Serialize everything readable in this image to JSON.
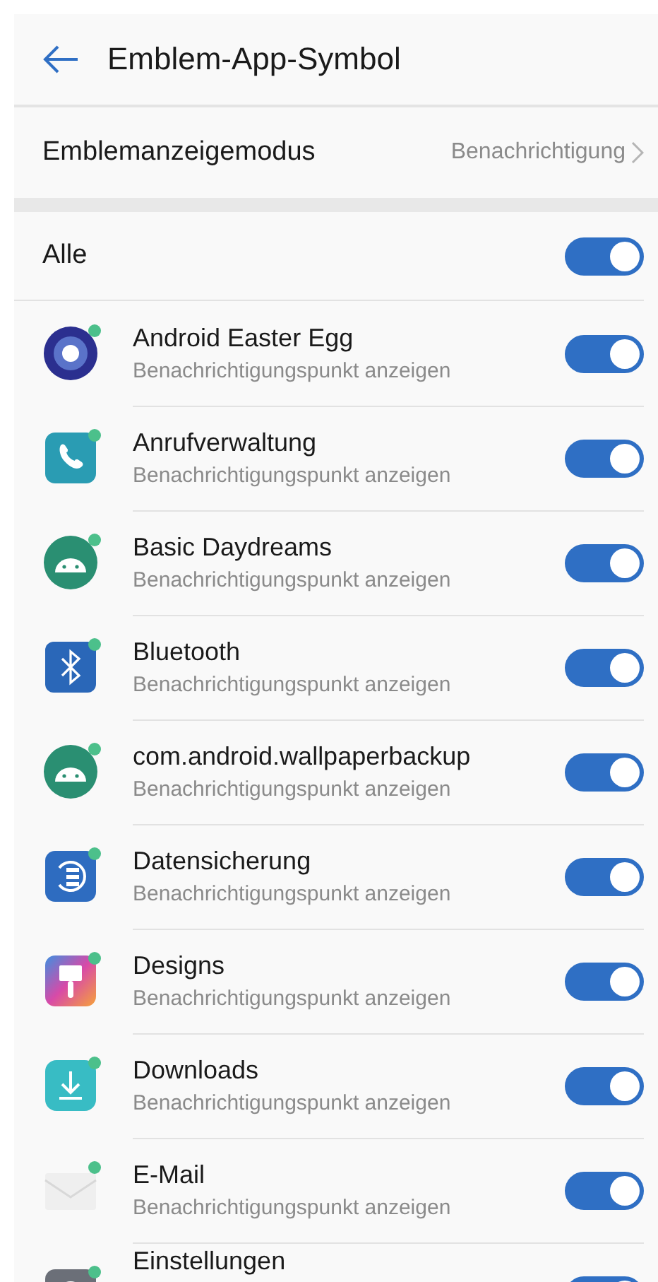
{
  "header": {
    "title": "Emblem-App-Symbol"
  },
  "mode": {
    "label": "Emblemanzeigemodus",
    "value": "Benachrichtigung"
  },
  "all": {
    "label": "Alle",
    "on": true
  },
  "apps": [
    {
      "name": "Android Easter Egg",
      "subtitle": "Benachrichtigungspunkt anzeigen",
      "kind": "ring",
      "on": true
    },
    {
      "name": "Anrufverwaltung",
      "subtitle": "Benachrichtigungspunkt anzeigen",
      "kind": "phone",
      "on": true
    },
    {
      "name": "Basic Daydreams",
      "subtitle": "Benachrichtigungspunkt anzeigen",
      "kind": "android",
      "on": true
    },
    {
      "name": "Bluetooth",
      "subtitle": "Benachrichtigungspunkt anzeigen",
      "kind": "bluetooth",
      "on": true
    },
    {
      "name": "com.android.wallpaperbackup",
      "subtitle": "Benachrichtigungspunkt anzeigen",
      "kind": "android",
      "on": true
    },
    {
      "name": "Datensicherung",
      "subtitle": "Benachrichtigungspunkt anzeigen",
      "kind": "backup",
      "on": true
    },
    {
      "name": "Designs",
      "subtitle": "Benachrichtigungspunkt anzeigen",
      "kind": "brush",
      "on": true
    },
    {
      "name": "Downloads",
      "subtitle": "Benachrichtigungspunkt anzeigen",
      "kind": "download",
      "on": true
    },
    {
      "name": "E-Mail",
      "subtitle": "Benachrichtigungspunkt anzeigen",
      "kind": "mail",
      "on": true
    },
    {
      "name": "Einstellungen",
      "kind": "gear",
      "on": true
    }
  ]
}
